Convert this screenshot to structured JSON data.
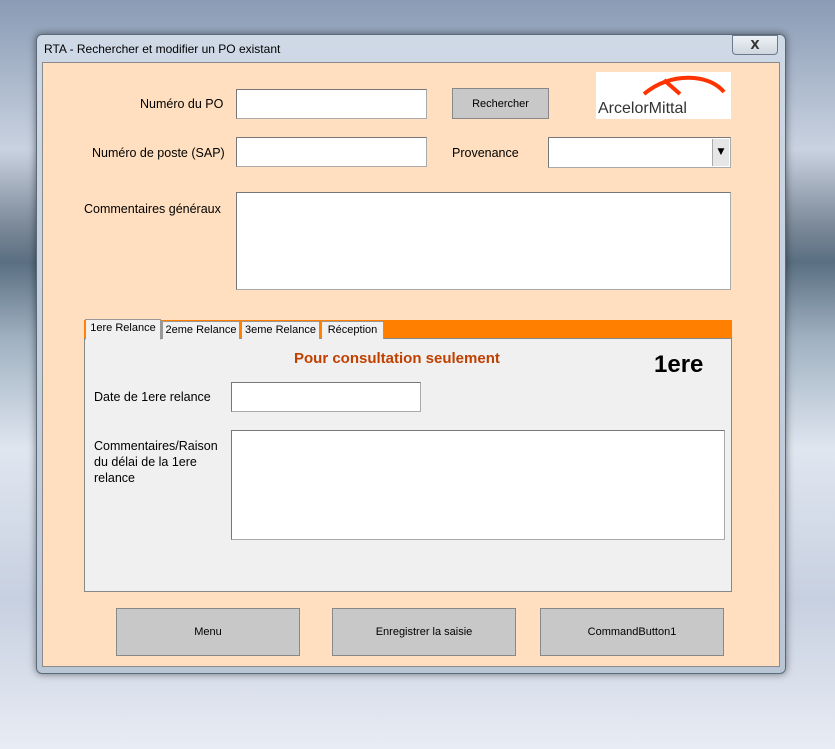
{
  "window": {
    "title": "RTA - Rechercher et modifier un PO existant",
    "close_label": "X"
  },
  "form": {
    "po_label": "Numéro du PO",
    "po_value": "",
    "search_button": "Rechercher",
    "logo_text": "ArcelorMittal",
    "poste_label": "Numéro de poste (SAP)",
    "poste_value": "",
    "provenance_label": "Provenance",
    "provenance_value": "",
    "comments_label": "Commentaires généraux",
    "comments_value": ""
  },
  "tabs": [
    {
      "label": "1ere Relance",
      "active": true
    },
    {
      "label": "2eme Relance"
    },
    {
      "label": "3eme Relance"
    },
    {
      "label": "Réception"
    }
  ],
  "tab_page": {
    "notice": "Pour consultation seulement",
    "badge": "1ere",
    "date_label": "Date de 1ere relance",
    "date_value": "",
    "reason_label": "Commentaires/Raison du délai de la 1ere relance",
    "reason_value": ""
  },
  "buttons": {
    "menu": "Menu",
    "save": "Enregistrer la saisie",
    "cmd1": "CommandButton1"
  },
  "colors": {
    "accent": "#FF8000",
    "notice": "#C04000",
    "client_bg": "#FFDFBF"
  }
}
